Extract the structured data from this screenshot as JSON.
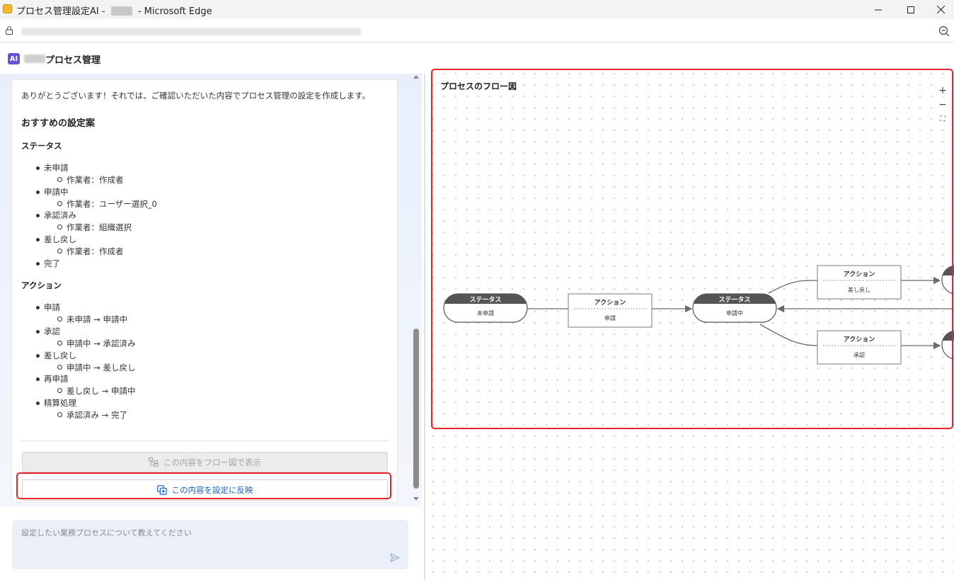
{
  "browser": {
    "title_prefix": "プロセス管理設定AI - ",
    "title_suffix": " - Microsoft Edge"
  },
  "header": {
    "title": "プロセス管理"
  },
  "chat": {
    "message": "ありがとうございます！それでは、ご確認いただいた内容でプロセス管理の設定を作成します。",
    "heading": "おすすめの設定案",
    "status_heading": "ステータス",
    "statuses": [
      {
        "name": "未申請",
        "worker": "作業者：作成者"
      },
      {
        "name": "申請中",
        "worker": "作業者：ユーザー選択_0"
      },
      {
        "name": "承認済み",
        "worker": "作業者：組織選択"
      },
      {
        "name": "差し戻し",
        "worker": "作業者：作成者"
      },
      {
        "name": "完了"
      }
    ],
    "action_heading": "アクション",
    "actions": [
      {
        "name": "申請",
        "transition": "未申請 → 申請中"
      },
      {
        "name": "承認",
        "transition": "申請中 → 承認済み"
      },
      {
        "name": "差し戻し",
        "transition": "申請中 → 差し戻し"
      },
      {
        "name": "再申請",
        "transition": "差し戻し → 申請中"
      },
      {
        "name": "精算処理",
        "transition": "承認済み → 完了"
      }
    ],
    "show_flow_button": "この内容をフロー図で表示",
    "apply_button": "この内容を設定に反映",
    "input_placeholder": "設定したい業務プロセスについて教えてください"
  },
  "flow": {
    "title": "プロセスのフロー図",
    "zoom_in": "+",
    "zoom_out": "−",
    "fit": "⛶",
    "status_header": "ステータス",
    "action_header": "アクション",
    "nodes": {
      "status1": "未申請",
      "action1": "申請",
      "status2": "申請中",
      "action_top": "差し戻し",
      "action_bottom": "承認"
    }
  },
  "colors": {
    "accent_red": "#e8232a",
    "link_blue": "#1560c9",
    "status_header": "#555555",
    "ai_badge": "#6b4fd8"
  }
}
